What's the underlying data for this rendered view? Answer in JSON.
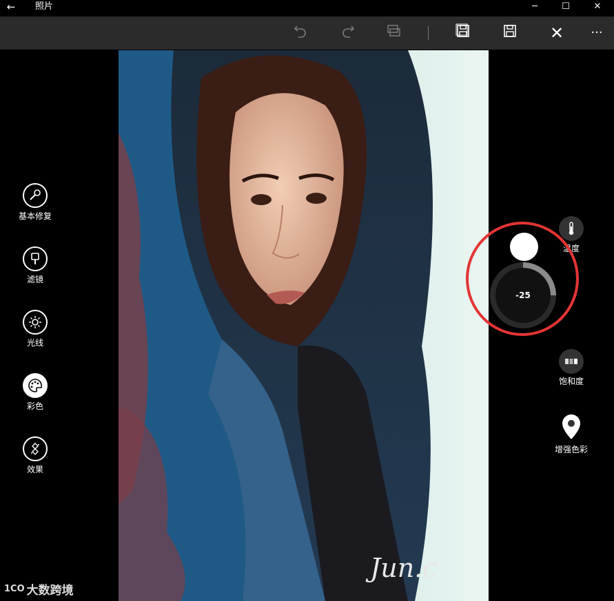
{
  "app": {
    "title": "照片"
  },
  "window": {
    "back": "←",
    "minimize": "─",
    "maximize": "☐",
    "close": "✕"
  },
  "toolbar": {
    "more": "···",
    "close": "✕"
  },
  "left_tools": [
    {
      "label": "基本修复",
      "icon": "wrench-icon"
    },
    {
      "label": "滤镜",
      "icon": "brush-icon"
    },
    {
      "label": "光线",
      "icon": "sun-icon"
    },
    {
      "label": "彩色",
      "icon": "palette-icon"
    },
    {
      "label": "效果",
      "icon": "effects-icon"
    }
  ],
  "right_tools": [
    {
      "label": "温度",
      "icon": "thermometer-icon"
    },
    {
      "label": "饱和度",
      "icon": "saturation-icon"
    },
    {
      "label": "增强色彩",
      "icon": "map-pin-icon"
    }
  ],
  "dial": {
    "value": "-25",
    "fraction": 0.25
  },
  "photo": {
    "signature": "Jun.c"
  },
  "watermark": {
    "text": "大数跨境",
    "logo": "1CO"
  },
  "colors": {
    "toolbar_bg": "#2b2b2b",
    "annotation": "#e33535"
  }
}
